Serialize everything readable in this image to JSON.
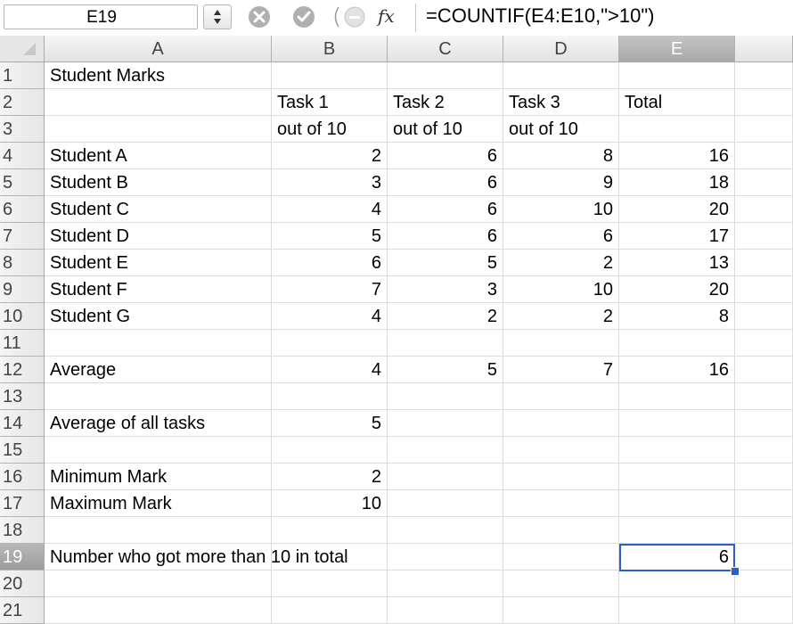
{
  "formula_bar": {
    "cell_ref": "E19",
    "formula": "=COUNTIF(E4:E10,\">10\")",
    "fx_label": "fx"
  },
  "grid": {
    "columns": [
      "A",
      "B",
      "C",
      "D",
      "E",
      ""
    ],
    "rows": [
      "1",
      "2",
      "3",
      "4",
      "5",
      "6",
      "7",
      "8",
      "9",
      "10",
      "11",
      "12",
      "13",
      "14",
      "15",
      "16",
      "17",
      "18",
      "19",
      "20",
      "21"
    ],
    "selected_cell": "E19",
    "cells": [
      [
        "Student Marks",
        "",
        "",
        "",
        ""
      ],
      [
        "",
        "Task 1",
        "Task 2",
        "Task 3",
        "Total"
      ],
      [
        "",
        "out of 10",
        "out of 10",
        "out of 10",
        ""
      ],
      [
        "Student A",
        "2",
        "6",
        "8",
        "16"
      ],
      [
        "Student B",
        "3",
        "6",
        "9",
        "18"
      ],
      [
        "Student C",
        "4",
        "6",
        "10",
        "20"
      ],
      [
        "Student D",
        "5",
        "6",
        "6",
        "17"
      ],
      [
        "Student E",
        "6",
        "5",
        "2",
        "13"
      ],
      [
        "Student F",
        "7",
        "3",
        "10",
        "20"
      ],
      [
        "Student G",
        "4",
        "2",
        "2",
        "8"
      ],
      [
        "",
        "",
        "",
        "",
        ""
      ],
      [
        "Average",
        "4",
        "5",
        "7",
        "16"
      ],
      [
        "",
        "",
        "",
        "",
        ""
      ],
      [
        "Average of all tasks",
        "5",
        "",
        "",
        ""
      ],
      [
        "",
        "",
        "",
        "",
        ""
      ],
      [
        "Minimum Mark",
        "2",
        "",
        "",
        ""
      ],
      [
        "Maximum Mark",
        "10",
        "",
        "",
        ""
      ],
      [
        "",
        "",
        "",
        "",
        ""
      ],
      [
        "Number who got more than 10 in total",
        "",
        "",
        "",
        "6"
      ],
      [
        "",
        "",
        "",
        "",
        ""
      ],
      [
        "",
        "",
        "",
        "",
        ""
      ]
    ]
  },
  "icons": {
    "stepper": "up-down-arrows-icon",
    "cancel": "cancel-x-icon",
    "enter": "checkmark-icon",
    "function": "function-icon"
  }
}
